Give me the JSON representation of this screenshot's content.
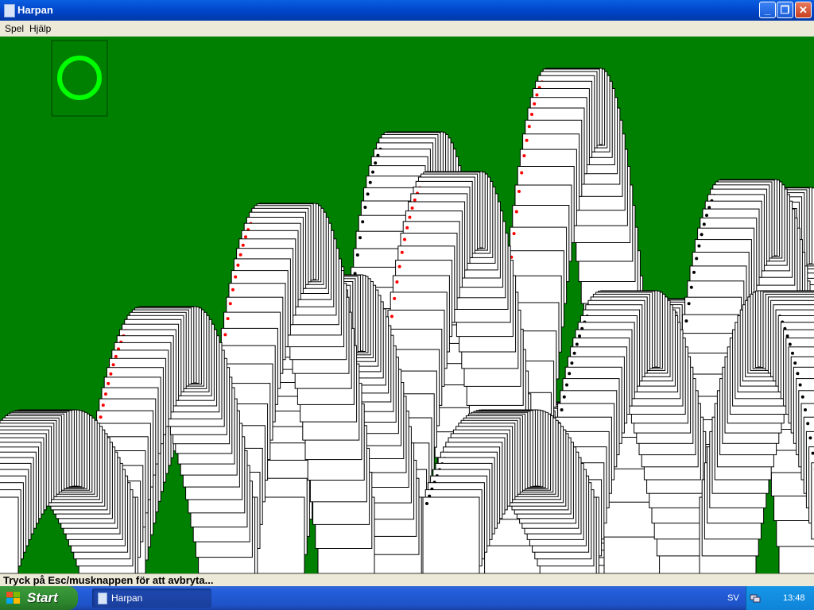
{
  "window": {
    "title": "Harpan"
  },
  "menu": {
    "items": [
      "Spel",
      "Hjälp"
    ]
  },
  "status": {
    "text": "Tryck på Esc/musknappen för att avbryta..."
  },
  "taskbar": {
    "start_label": "Start",
    "task_label": "Harpan",
    "language": "SV",
    "clock": "13:48"
  },
  "colors": {
    "felt": "#008000",
    "ring": "#00ff00",
    "card_red": "#ff0000",
    "card_black": "#000000"
  },
  "icons": [
    "app-icon",
    "minimize-icon",
    "maximize-icon",
    "close-icon",
    "stock-ring-icon",
    "windows-flag-icon",
    "network-icon"
  ]
}
